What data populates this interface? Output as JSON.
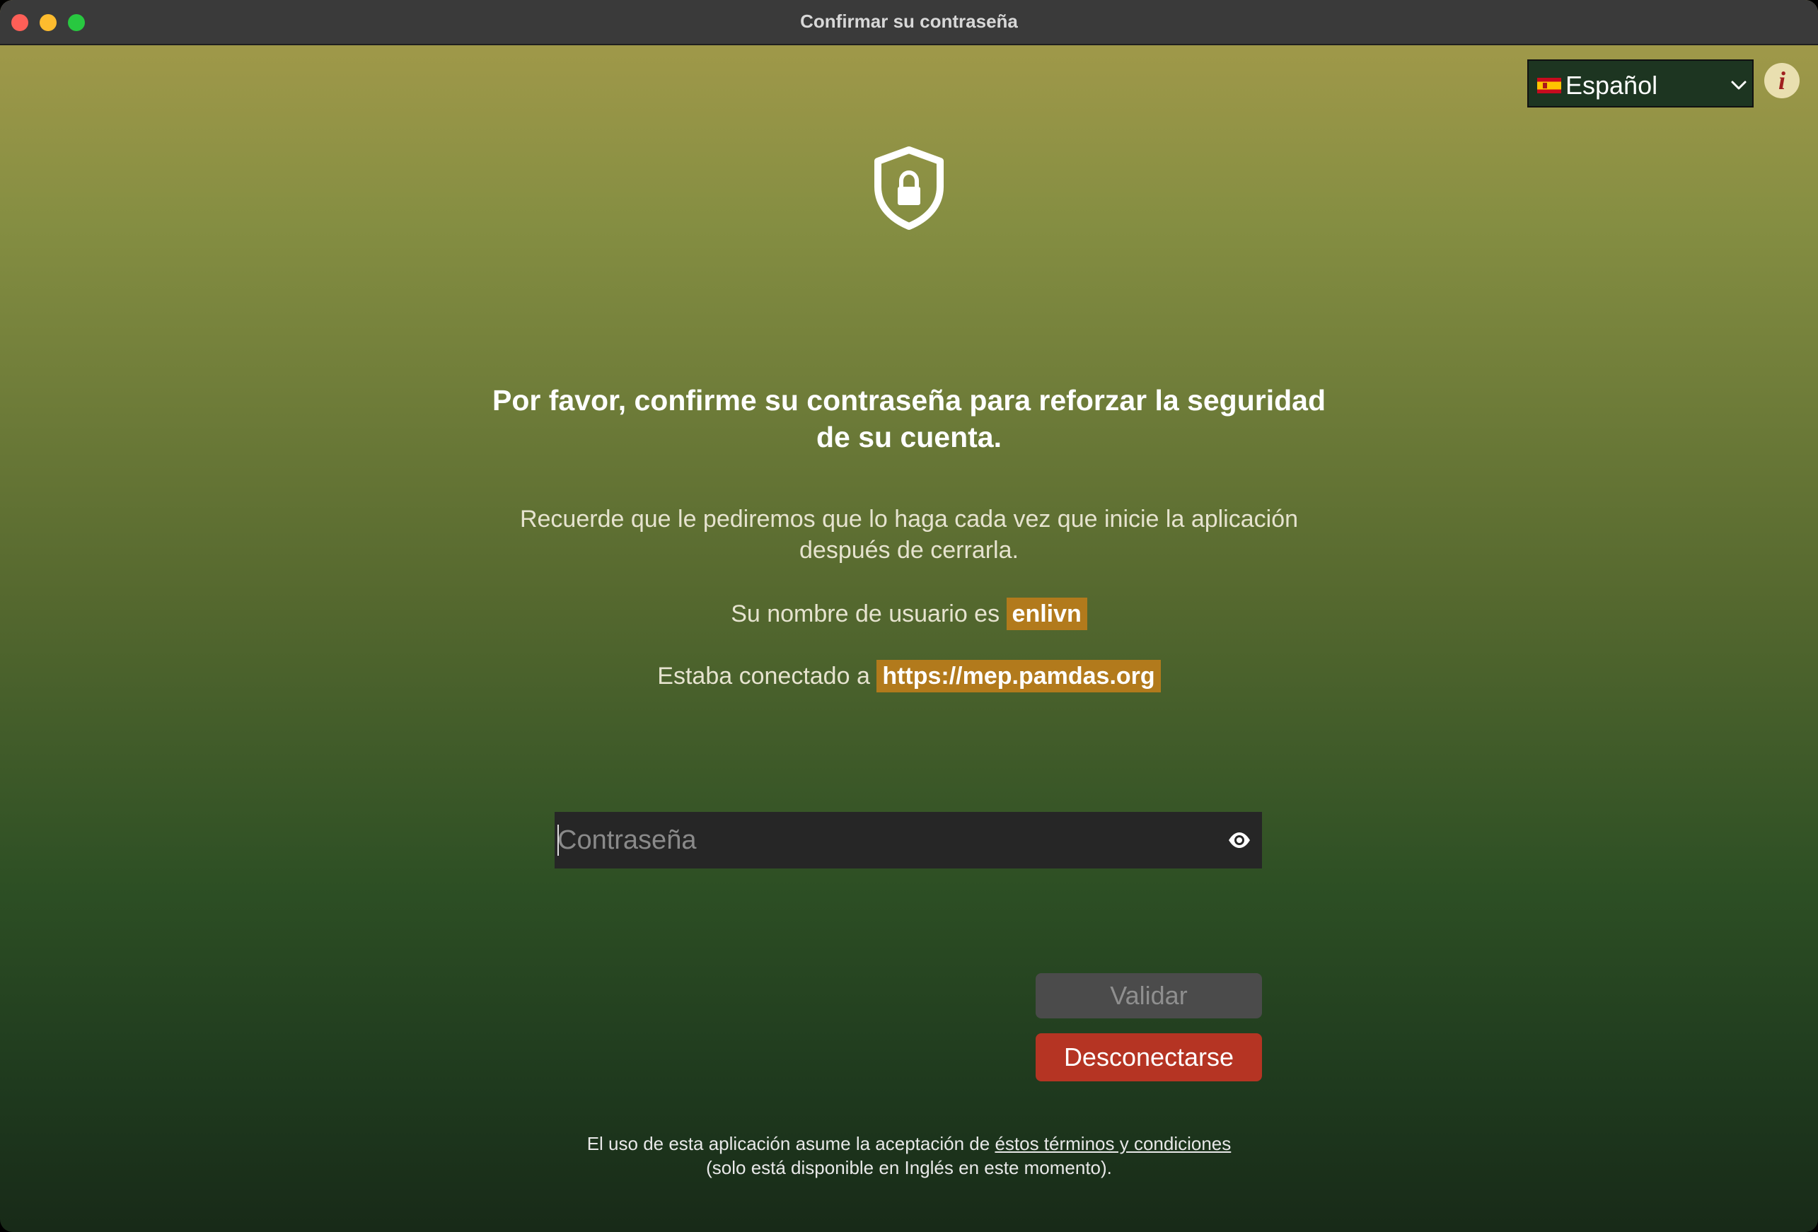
{
  "window": {
    "title": "Confirmar su contraseña"
  },
  "language_select": {
    "selected": "Español",
    "flag_icon": "spain-flag-icon",
    "chevron_icon": "chevron-down-icon"
  },
  "info_button": {
    "glyph": "i",
    "icon": "info-icon"
  },
  "main": {
    "shield_icon": "shield-lock-icon",
    "headline": "Por favor, confirme su contraseña para reforzar la seguridad de su cuenta.",
    "reminder": "Recuerde que le pediremos que lo haga cada vez que inicie la aplicación después de cerrarla.",
    "username_prefix": "Su nombre de usuario es",
    "username": "enlivn",
    "server_prefix": "Estaba conectado a",
    "server_url": "https://mep.pamdas.org",
    "password_placeholder": "Contraseña",
    "password_value": "",
    "eye_icon": "eye-icon",
    "validate_label": "Validar",
    "logout_label": "Desconectarse"
  },
  "footer": {
    "prefix": "El uso de esta aplicación asume la aceptación de",
    "terms_link": "éstos términos y condiciones",
    "line2": "(solo está disponible en Inglés en este momento)."
  },
  "colors": {
    "highlight": "#b27a1c",
    "logout_button": "#b53423",
    "validate_button": "#4b4b4b",
    "info_glyph": "#a01f1f"
  }
}
